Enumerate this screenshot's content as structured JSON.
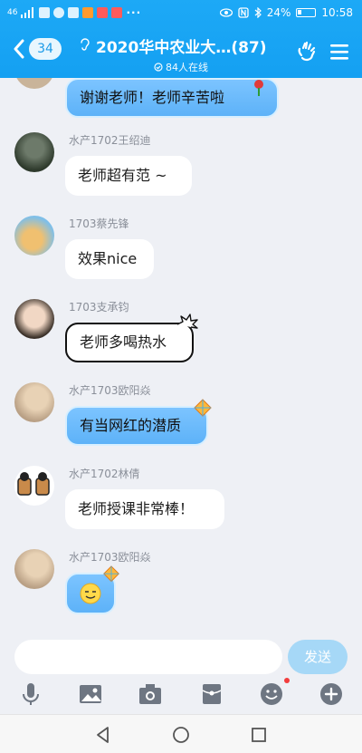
{
  "status_bar": {
    "network_label": "46",
    "more": "···",
    "battery": "24%",
    "time": "10:58"
  },
  "header": {
    "back_count": "34",
    "title": "2020华中农业大…(87)",
    "online": "84人在线"
  },
  "messages": [
    {
      "name": "",
      "text": "谢谢老师！老师辛苦啦",
      "style": "blue"
    },
    {
      "name": "水产1702王绍迪",
      "text": "老师超有范 ~",
      "style": "white"
    },
    {
      "name": "1703蔡先锋",
      "text": "效果nice",
      "style": "white"
    },
    {
      "name": "1703支承钧",
      "text": "老师多喝热水",
      "style": "comic"
    },
    {
      "name": "水产1703欧阳焱",
      "text": "有当网红的潜质",
      "style": "blue"
    },
    {
      "name": "水产1702林倩",
      "text": "老师授课非常棒！",
      "style": "white"
    },
    {
      "name": "水产1703欧阳焱",
      "text": "",
      "style": "blue-emoji"
    }
  ],
  "input": {
    "placeholder": "",
    "send_label": "发送"
  },
  "toolbar_icons": [
    "mic-icon",
    "image-icon",
    "camera-icon",
    "red-packet-icon",
    "emoji-icon",
    "plus-icon"
  ],
  "colors": {
    "header_blue": "#14a0f2",
    "bubble_blue": "#5db2f8",
    "send_disabled": "#a6d8f7",
    "background": "#eef0f5"
  }
}
